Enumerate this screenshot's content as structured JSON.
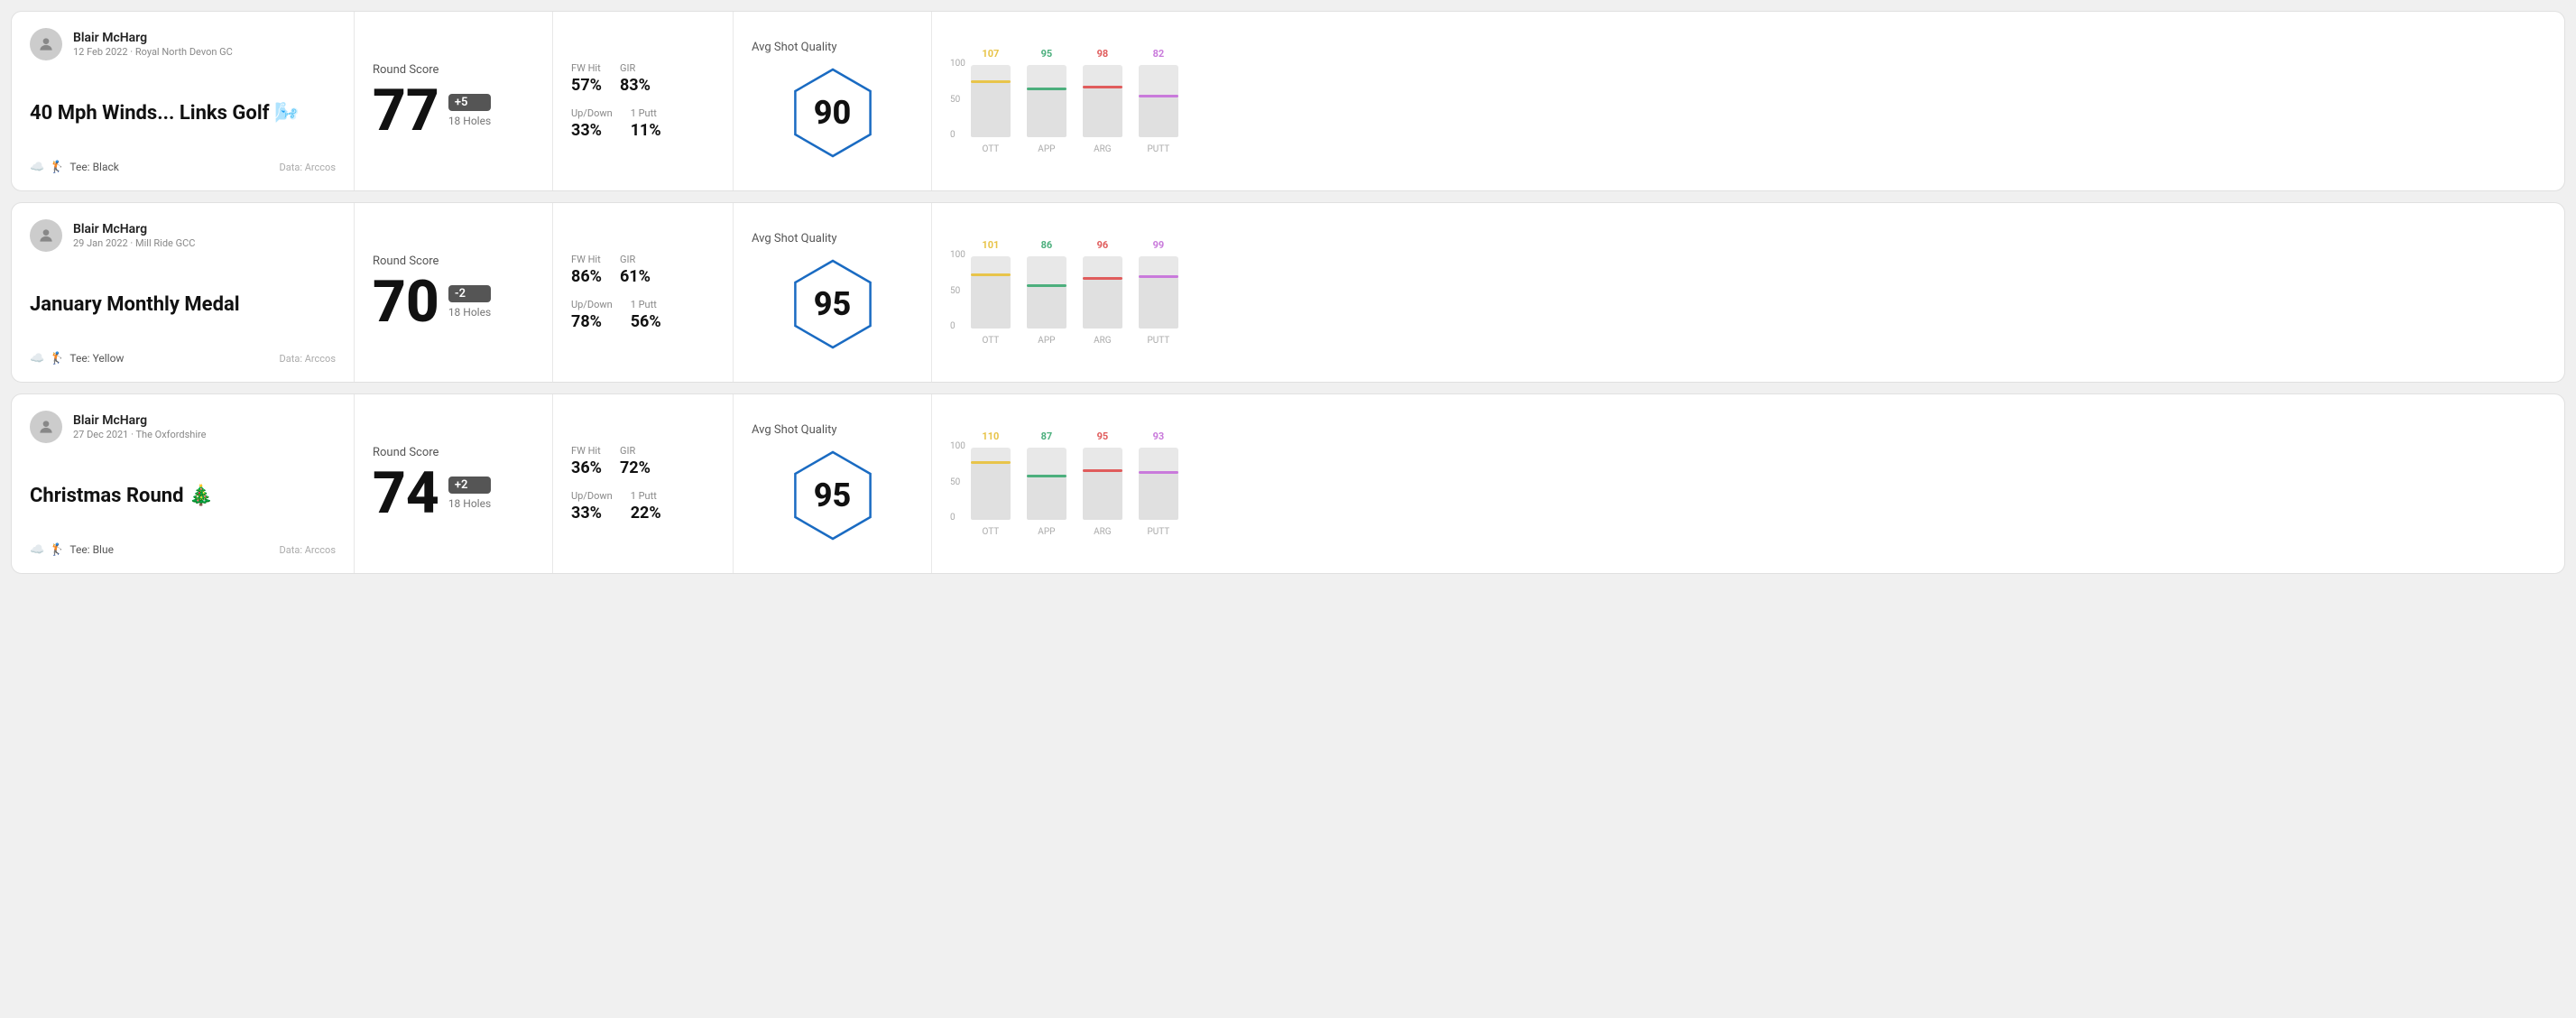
{
  "rounds": [
    {
      "id": "round1",
      "player": "Blair McHarg",
      "date": "12 Feb 2022 · Royal North Devon GC",
      "title": "40 Mph Winds... Links Golf 🌬️",
      "tee": "Black",
      "dataSource": "Data: Arccos",
      "score": 77,
      "scoreDiff": "+5",
      "scoreDiffType": "over",
      "holes": "18 Holes",
      "fwHit": "57%",
      "gir": "83%",
      "upDown": "33%",
      "onePutt": "11%",
      "avgShotQuality": 90,
      "chart": {
        "ott": {
          "value": 107,
          "color": "#e8c44a",
          "pct": 75
        },
        "app": {
          "value": 95,
          "color": "#4caf7d",
          "pct": 65
        },
        "arg": {
          "value": 98,
          "color": "#e05c5c",
          "pct": 68
        },
        "putt": {
          "value": 82,
          "color": "#c97adb",
          "pct": 55
        }
      }
    },
    {
      "id": "round2",
      "player": "Blair McHarg",
      "date": "29 Jan 2022 · Mill Ride GCC",
      "title": "January Monthly Medal",
      "tee": "Yellow",
      "dataSource": "Data: Arccos",
      "score": 70,
      "scoreDiff": "-2",
      "scoreDiffType": "under",
      "holes": "18 Holes",
      "fwHit": "86%",
      "gir": "61%",
      "upDown": "78%",
      "onePutt": "56%",
      "avgShotQuality": 95,
      "chart": {
        "ott": {
          "value": 101,
          "color": "#e8c44a",
          "pct": 72
        },
        "app": {
          "value": 86,
          "color": "#4caf7d",
          "pct": 58
        },
        "arg": {
          "value": 96,
          "color": "#e05c5c",
          "pct": 67
        },
        "putt": {
          "value": 99,
          "color": "#c97adb",
          "pct": 70
        }
      }
    },
    {
      "id": "round3",
      "player": "Blair McHarg",
      "date": "27 Dec 2021 · The Oxfordshire",
      "title": "Christmas Round 🎄",
      "tee": "Blue",
      "dataSource": "Data: Arccos",
      "score": 74,
      "scoreDiff": "+2",
      "scoreDiffType": "over",
      "holes": "18 Holes",
      "fwHit": "36%",
      "gir": "72%",
      "upDown": "33%",
      "onePutt": "22%",
      "avgShotQuality": 95,
      "chart": {
        "ott": {
          "value": 110,
          "color": "#e8c44a",
          "pct": 78
        },
        "app": {
          "value": 87,
          "color": "#4caf7d",
          "pct": 59
        },
        "arg": {
          "value": 95,
          "color": "#e05c5c",
          "pct": 66
        },
        "putt": {
          "value": 93,
          "color": "#c97adb",
          "pct": 64
        }
      }
    }
  ],
  "chartYLabels": [
    "100",
    "50",
    "0"
  ],
  "chartCategories": [
    "OTT",
    "APP",
    "ARG",
    "PUTT"
  ]
}
